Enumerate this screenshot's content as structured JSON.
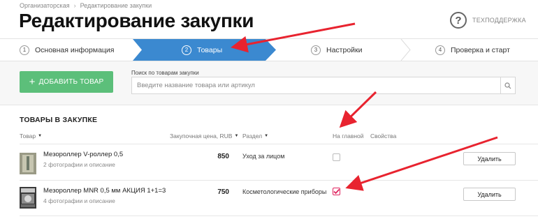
{
  "breadcrumb": [
    "Организаторская",
    "Редактирование закупки"
  ],
  "page_title": "Редактирование закупки",
  "support_label": "ТЕХПОДДЕРЖКА",
  "steps": [
    {
      "num": "1",
      "label": "Основная информация"
    },
    {
      "num": "2",
      "label": "Товары"
    },
    {
      "num": "3",
      "label": "Настройки"
    },
    {
      "num": "4",
      "label": "Проверка и старт"
    }
  ],
  "add_button": "ДОБАВИТЬ ТОВАР",
  "search": {
    "label": "Поиск по товарам закупки",
    "placeholder": "Введите название товара или артикул"
  },
  "section_title": "ТОВАРЫ В ЗАКУПКЕ",
  "columns": {
    "product": "Товар",
    "price": "Закупочная цена, RUB",
    "section": "Раздел",
    "on_main": "На главной",
    "props": "Свойства"
  },
  "rows": [
    {
      "name": "Мезороллер V-роллер 0,5",
      "sub": "2 фотографии и описание",
      "price": "850",
      "section": "Уход за лицом",
      "on_main": false,
      "delete": "Удалить"
    },
    {
      "name": "Мезороллер MNR 0,5 мм АКЦИЯ 1+1=3",
      "sub": "4 фотографии и описание",
      "price": "750",
      "section": "Косметологические приборы",
      "on_main": true,
      "delete": "Удалить"
    }
  ],
  "colors": {
    "accent_blue": "#3b89d0",
    "green": "#5cbf7a",
    "arrow_red": "#e8232f",
    "check_pink": "#e0245e"
  }
}
